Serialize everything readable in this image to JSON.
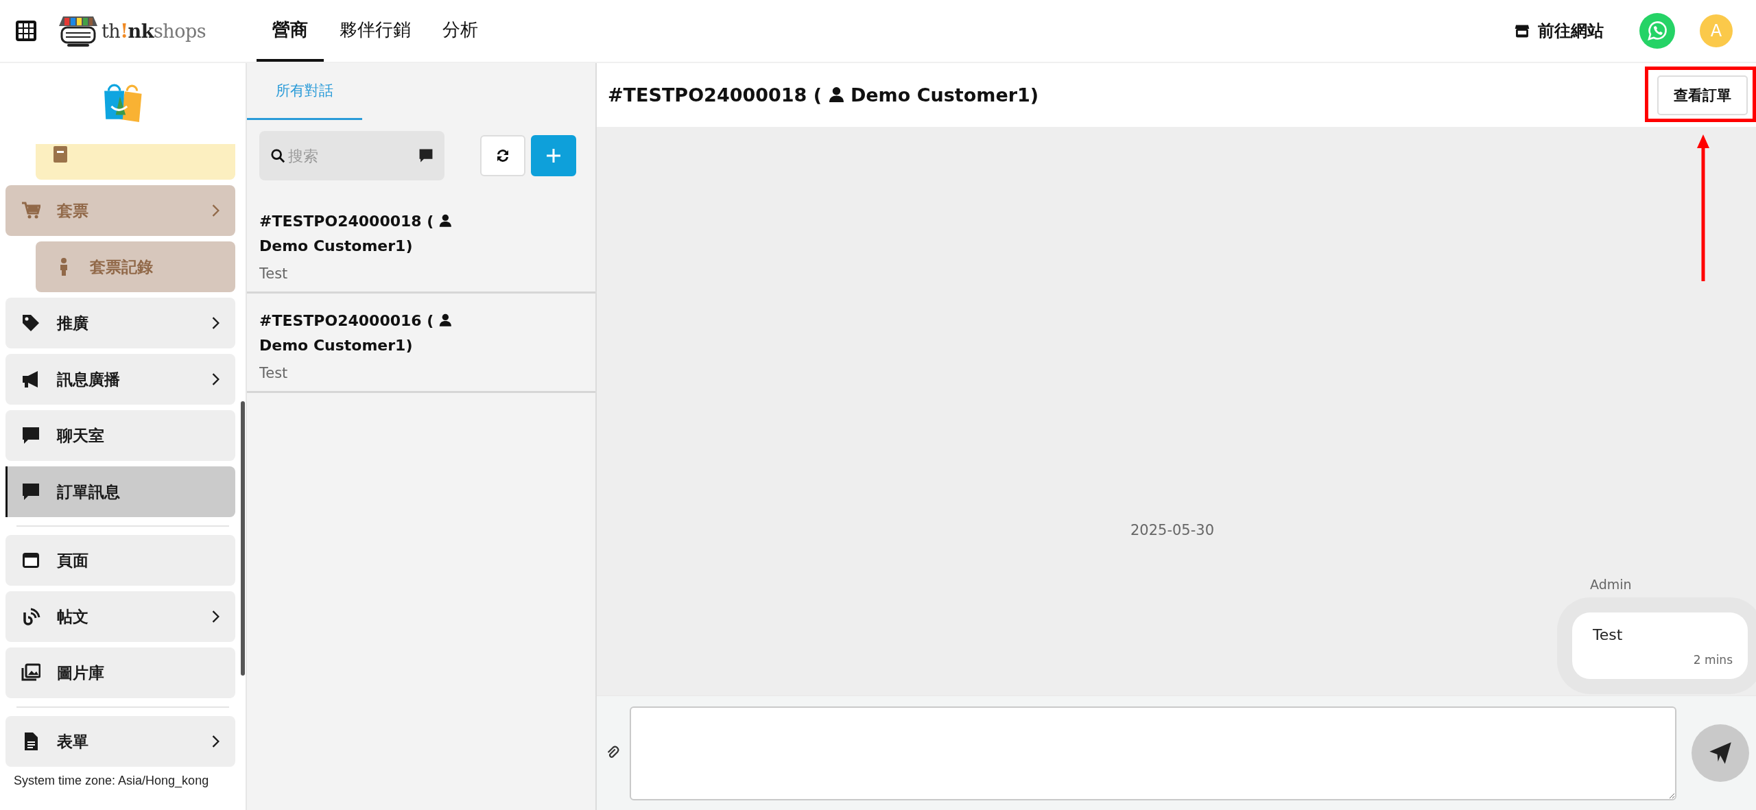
{
  "topbar": {
    "logo_text": "th!nkshops",
    "tabs": [
      {
        "label": "營商",
        "selected": true
      },
      {
        "label": "夥伴行銷",
        "selected": false
      },
      {
        "label": "分析",
        "selected": false
      }
    ],
    "site_link": "前往網站",
    "avatar": "A"
  },
  "sidebar": {
    "sections": [
      [
        {
          "kind": "subitem",
          "color": "#fcefc0",
          "selected": false
        },
        {
          "kind": "item",
          "label": "套票",
          "color": "#d7c7bc",
          "expandable": true,
          "selected": false
        },
        {
          "kind": "subitem",
          "label": "套票記錄",
          "color": "#d7c7bc",
          "selected": false
        },
        {
          "kind": "item",
          "label": "推廣",
          "expandable": true,
          "selected": false
        },
        {
          "kind": "item",
          "label": "訊息廣播",
          "expandable": true,
          "selected": false
        },
        {
          "kind": "item",
          "label": "聊天室",
          "expandable": false,
          "selected": false
        },
        {
          "kind": "item",
          "label": "訂單訊息",
          "expandable": false,
          "selected": true
        }
      ],
      [
        {
          "kind": "item",
          "label": "頁面",
          "expandable": false,
          "selected": false
        },
        {
          "kind": "item",
          "label": "帖文",
          "expandable": true,
          "selected": false
        },
        {
          "kind": "item",
          "label": "圖片庫",
          "expandable": false,
          "selected": false
        }
      ],
      [
        {
          "kind": "item",
          "label": "表單",
          "expandable": true,
          "selected": false
        }
      ]
    ],
    "footer": "System time zone: Asia/Hong_kong"
  },
  "conversations": {
    "tabs": [
      {
        "label": "所有對話",
        "selected": true
      }
    ],
    "search": {
      "placeholder": "搜索"
    },
    "items": [
      {
        "order": "#TESTPO24000018 (",
        "customer": "Demo Customer1)",
        "preview": "Test"
      },
      {
        "order": "#TESTPO24000016 (",
        "customer": "Demo Customer1)",
        "preview": "Test"
      }
    ]
  },
  "chat": {
    "order": "#TESTPO24000018 (",
    "customer": "Demo Customer1)",
    "view_order_button": "查看訂單",
    "date": "2025-05-30",
    "messages": [
      {
        "sender": "Admin",
        "text": "Test",
        "time": "2 mins"
      }
    ]
  }
}
